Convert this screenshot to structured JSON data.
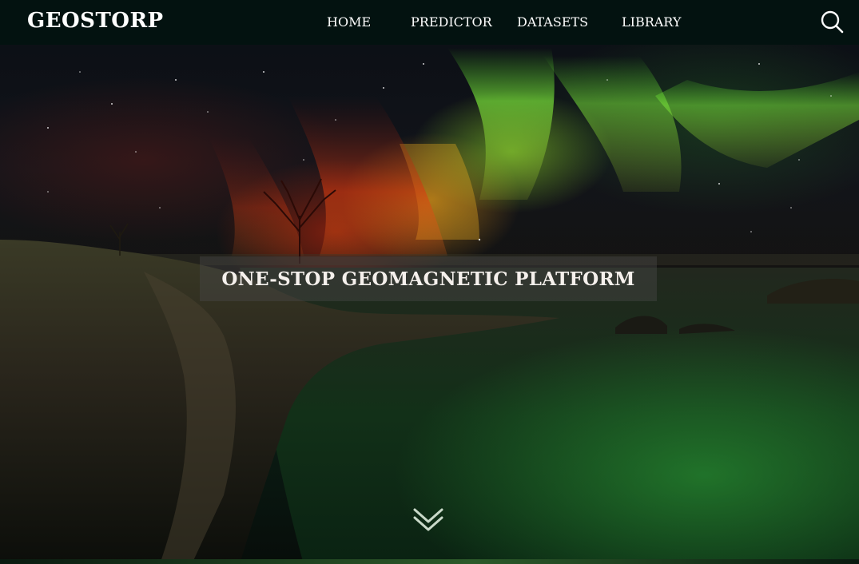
{
  "navbar": {
    "brand": "GEOSTORP",
    "links": [
      {
        "label": "HOME"
      },
      {
        "label": "PREDICTOR"
      },
      {
        "label": "DATASETS"
      },
      {
        "label": "LIBRARY"
      }
    ],
    "search_icon": "search-icon"
  },
  "hero": {
    "image": "aurora-over-coastal-cliff",
    "headline": "ONE-STOP GEOMAGNETIC PLATFORM",
    "scroll_icon": "double-chevron-down-icon"
  },
  "colors": {
    "navbar_bg": "#031210",
    "nav_text": "#ffffff",
    "headline_text": "#f5f0ec",
    "aurora_green": "#7ee63a",
    "aurora_red": "#d2380c"
  }
}
